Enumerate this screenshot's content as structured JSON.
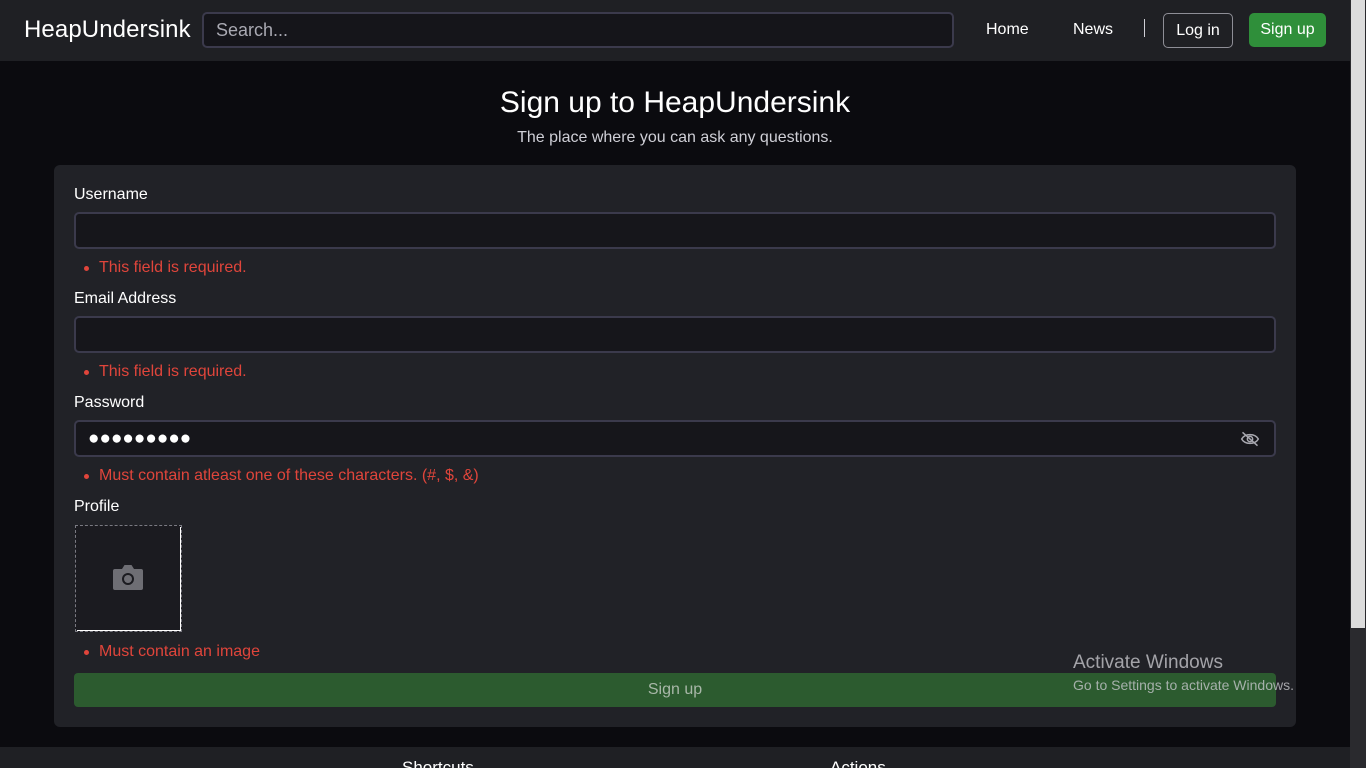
{
  "navbar": {
    "brand": "HeapUndersink",
    "search_placeholder": "Search...",
    "links": [
      "Home",
      "News"
    ],
    "login_label": "Log in",
    "signup_label": "Sign up"
  },
  "header": {
    "title": "Sign up to HeapUndersink",
    "subtitle": "The place where you can ask any questions."
  },
  "form": {
    "username": {
      "label": "Username",
      "value": "",
      "error": "This field is required."
    },
    "email": {
      "label": "Email Address",
      "value": "",
      "error": "This field is required."
    },
    "password": {
      "label": "Password",
      "value": "●●●●●●●●●",
      "error": "Must contain atleast one of these characters. (#, $, &)",
      "toggle_icon": "eye-slash-icon"
    },
    "profile": {
      "label": "Profile",
      "icon": "camera-icon",
      "error": "Must contain an image"
    },
    "submit_label": "Sign up"
  },
  "footer": {
    "headings": [
      "Shortcuts",
      "Actions"
    ]
  },
  "watermark": {
    "title": "Activate Windows",
    "subtitle": "Go to Settings to activate Windows."
  },
  "colors": {
    "accent_green": "#2f8f3a",
    "error_red": "#e0453b",
    "card_bg": "#212227",
    "page_bg": "#0b0b0f"
  }
}
